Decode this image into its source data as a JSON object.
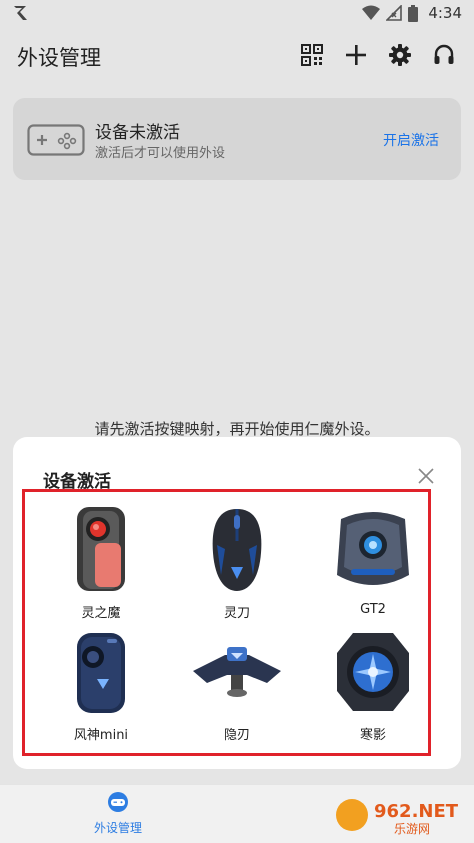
{
  "status": {
    "time": "4:34"
  },
  "header": {
    "title": "外设管理",
    "icons": [
      "qr-code-icon",
      "plus-icon",
      "gear-icon",
      "headset-icon"
    ]
  },
  "device_card": {
    "title": "设备未激活",
    "subtitle": "激活后才可以使用外设",
    "action": "开启激活"
  },
  "hint": "请先激活按键映射，再开始使用仁魔外设。",
  "sheet": {
    "title": "设备激活",
    "devices": [
      {
        "label": "灵之魔"
      },
      {
        "label": "灵刀"
      },
      {
        "label": "GT2"
      },
      {
        "label": "风神mini"
      },
      {
        "label": "隐刃"
      },
      {
        "label": "寒影"
      }
    ]
  },
  "bottom_nav": {
    "label": "外设管理"
  },
  "watermark": {
    "brand": "962.NET",
    "sub": "乐游网"
  },
  "colors": {
    "accent": "#2d7de2",
    "highlight": "#e0222a",
    "link": "#1a73e8"
  }
}
